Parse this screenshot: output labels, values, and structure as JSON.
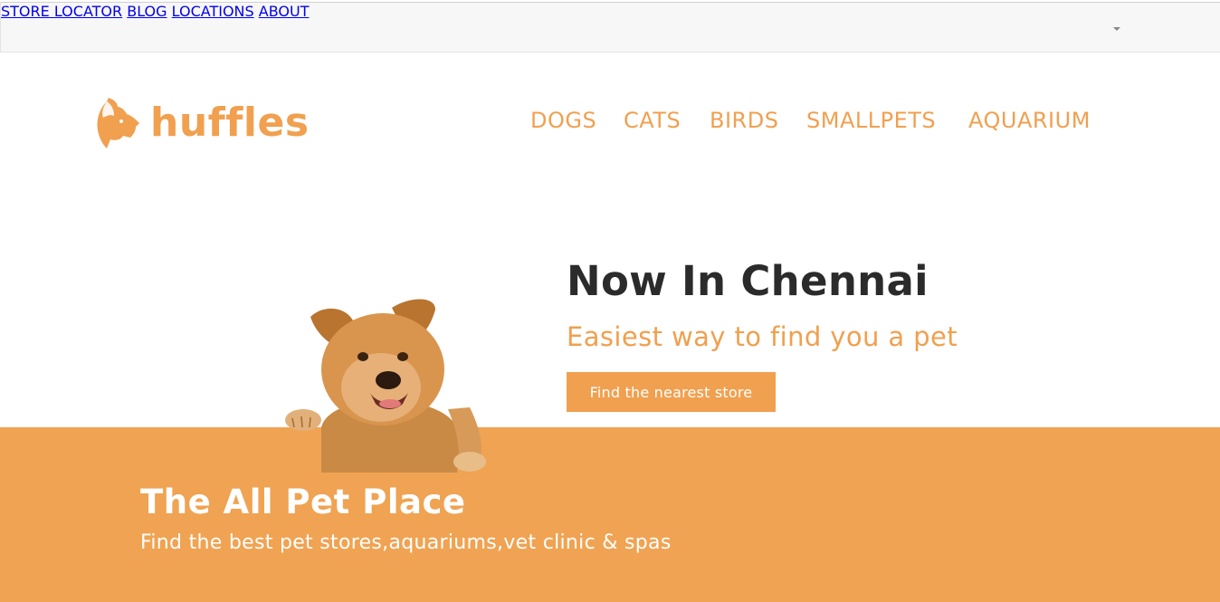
{
  "topbar": {
    "links": [
      {
        "label": "STORE LOCATOR"
      },
      {
        "label": "BLOG"
      },
      {
        "label": "LOCATIONS"
      },
      {
        "label": "ABOUT"
      }
    ],
    "about_icon": "caret-down-icon"
  },
  "header": {
    "logo_text": "huffles",
    "logo_icon": "dog-head-icon",
    "nav": [
      {
        "label": "DOGS"
      },
      {
        "label": "CATS"
      },
      {
        "label": "BIRDS"
      },
      {
        "label": "SMALLPETS"
      },
      {
        "label": "AQUARIUM"
      }
    ]
  },
  "hero": {
    "title": "Now In Chennai",
    "subtitle": "Easiest way to find you a pet",
    "cta_label": "Find the nearest store",
    "image": "dog-photo"
  },
  "band": {
    "title": "The All Pet Place",
    "subtitle": "Find the best pet stores,aquariums,vet clinic & spas"
  },
  "colors": {
    "accent": "#f0a04f",
    "band": "#f0a352",
    "topbar_bg": "#f7f7f7",
    "text_dark": "#2b2b2b"
  }
}
